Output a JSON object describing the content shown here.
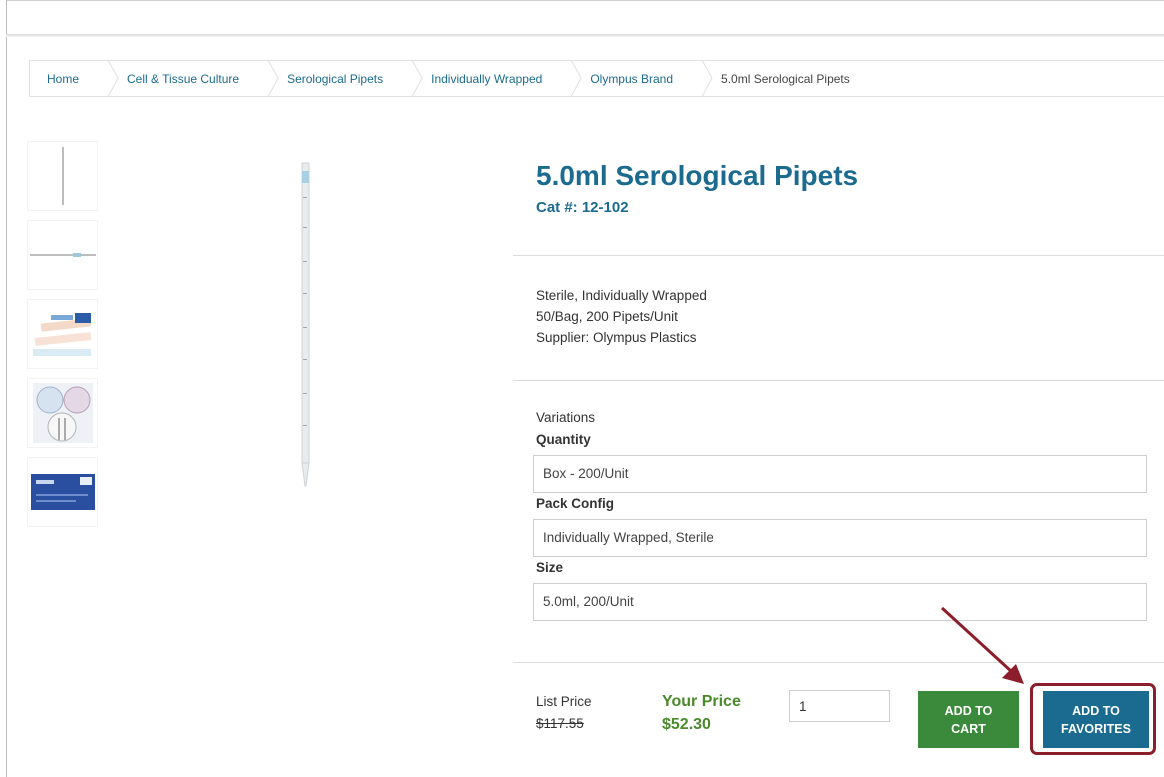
{
  "breadcrumb": {
    "items": [
      {
        "label": "Home"
      },
      {
        "label": "Cell & Tissue Culture"
      },
      {
        "label": "Serological Pipets"
      },
      {
        "label": "Individually Wrapped"
      },
      {
        "label": "Olympus Brand"
      },
      {
        "label": "5.0ml Serological Pipets"
      }
    ]
  },
  "product": {
    "title": "5.0ml Serological Pipets",
    "cat": "Cat #: 12-102",
    "desc": [
      "Sterile, Individually Wrapped",
      "50/Bag, 200 Pipets/Unit",
      "Supplier: Olympus Plastics"
    ],
    "variations_label": "Variations",
    "options": [
      {
        "label": "Quantity",
        "value": "Box - 200/Unit"
      },
      {
        "label": "Pack Config",
        "value": "Individually Wrapped, Sterile"
      },
      {
        "label": "Size",
        "value": "5.0ml, 200/Unit"
      }
    ]
  },
  "pricing": {
    "list_label": "List Price",
    "list_value": "$117.55",
    "your_label": "Your Price",
    "your_value": "$52.30",
    "quantity": "1"
  },
  "buttons": {
    "cart_line1": "ADD TO",
    "cart_line2": "CART",
    "fav_line1": "ADD TO",
    "fav_line2": "FAVORITES"
  },
  "colors": {
    "brand": "#1b6a8f",
    "price": "#4a8a2a",
    "cart": "#3b8a3b",
    "highlight": "#8b1e2a"
  },
  "icons": {
    "breadcrumb_separator": "chevron-right-icon",
    "annotation": "arrow-icon"
  }
}
